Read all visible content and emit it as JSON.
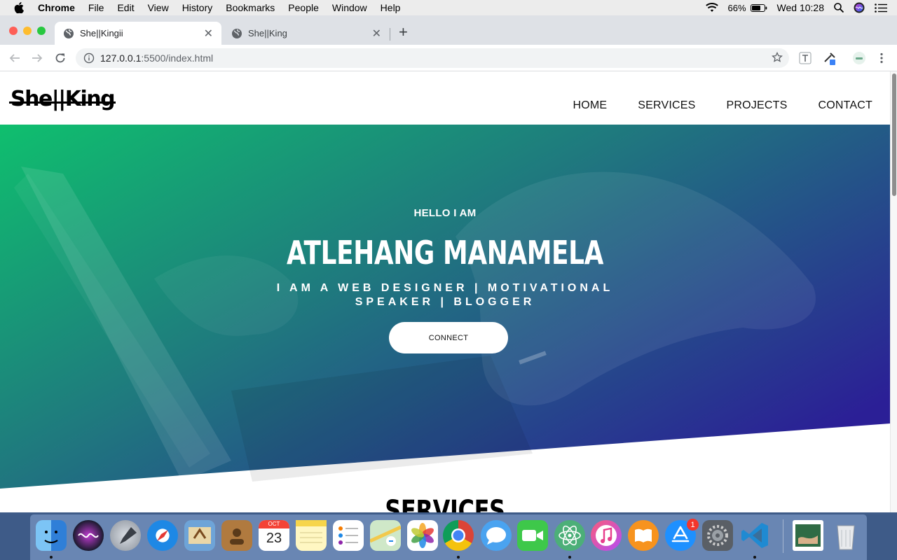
{
  "menubar": {
    "app_name": "Chrome",
    "items": [
      "File",
      "Edit",
      "View",
      "History",
      "Bookmarks",
      "People",
      "Window",
      "Help"
    ],
    "battery": "66%",
    "clock": "Wed 10:28"
  },
  "browser": {
    "tabs": [
      {
        "title": "She||Kingii",
        "active": true
      },
      {
        "title": "She||King",
        "active": false
      }
    ],
    "url_host": "127.0.0.1",
    "url_rest": ":5500/index.html"
  },
  "site": {
    "logo": "She||King",
    "nav": [
      "HOME",
      "SERVICES",
      "PROJECTS",
      "CONTACT"
    ],
    "hero": {
      "greeting": "HELLO I AM",
      "name": "ATLEHANG MANAMELA",
      "tagline": "I AM A WEB DESIGNER | MOTIVATIONAL SPEAKER | BLOGGER",
      "cta": "CONNECT",
      "gradient": [
        "#0fbf6e",
        "#2b1f96"
      ]
    },
    "section_title": "SERVICES"
  },
  "dock": {
    "apps": [
      "finder",
      "siri",
      "launchpad",
      "safari",
      "mail",
      "contacts",
      "calendar",
      "notes",
      "reminders",
      "maps",
      "photos",
      "chrome",
      "messages",
      "facetime",
      "atom",
      "itunes",
      "ibooks",
      "app-store",
      "system-preferences",
      "vscode",
      "preview",
      "trash"
    ],
    "calendar_month": "OCT",
    "calendar_day": "23",
    "app_store_badge": "1"
  }
}
